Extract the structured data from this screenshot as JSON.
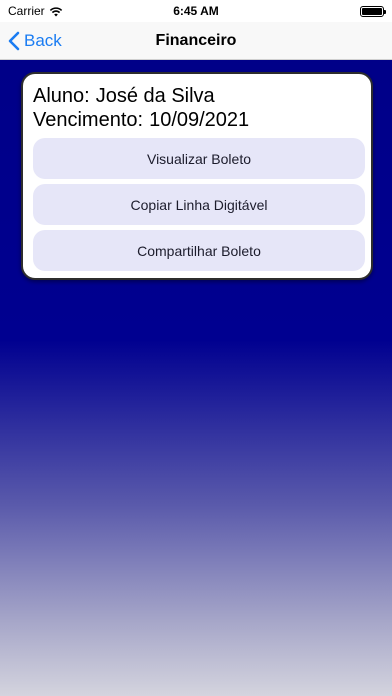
{
  "status_bar": {
    "carrier": "Carrier",
    "time": "6:45 AM"
  },
  "nav": {
    "back_label": "Back",
    "title": "Financeiro"
  },
  "card": {
    "student_label": "Aluno:",
    "student_name": "José da Silva",
    "due_label": "Vencimento:",
    "due_date": "10/09/2021",
    "buttons": [
      "Visualizar Boleto",
      "Copiar Linha Digitável",
      "Compartilhar Boleto"
    ]
  },
  "colors": {
    "accent": "#1a7cf2",
    "background_top": "#000088",
    "button_bg": "#e6e6f8"
  },
  "icons": [
    "wifi-icon",
    "battery-icon",
    "chevron-left-icon"
  ]
}
